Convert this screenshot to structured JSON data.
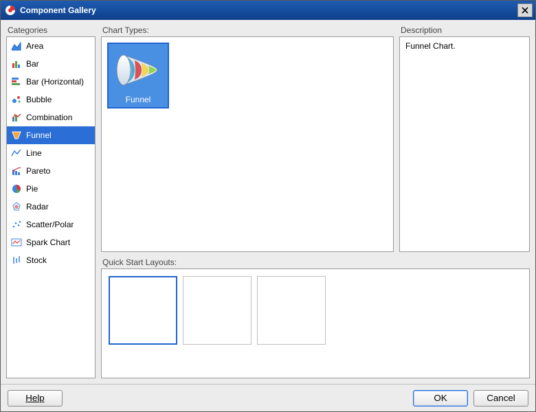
{
  "window": {
    "title": "Component Gallery"
  },
  "labels": {
    "categories": "Categories",
    "chart_types": "Chart Types:",
    "description": "Description",
    "quick_start": "Quick Start Layouts:"
  },
  "categories": {
    "selected_index": 5,
    "items": [
      {
        "label": "Area",
        "icon": "area"
      },
      {
        "label": "Bar",
        "icon": "bar"
      },
      {
        "label": "Bar (Horizontal)",
        "icon": "bar-h"
      },
      {
        "label": "Bubble",
        "icon": "bubble"
      },
      {
        "label": "Combination",
        "icon": "combination"
      },
      {
        "label": "Funnel",
        "icon": "funnel"
      },
      {
        "label": "Line",
        "icon": "line"
      },
      {
        "label": "Pareto",
        "icon": "pareto"
      },
      {
        "label": "Pie",
        "icon": "pie"
      },
      {
        "label": "Radar",
        "icon": "radar"
      },
      {
        "label": "Scatter/Polar",
        "icon": "scatter"
      },
      {
        "label": "Spark Chart",
        "icon": "spark"
      },
      {
        "label": "Stock",
        "icon": "stock"
      }
    ]
  },
  "chart_types": {
    "selected_index": 0,
    "items": [
      {
        "label": "Funnel"
      }
    ]
  },
  "description": {
    "text": "Funnel Chart."
  },
  "quick_start": {
    "selected_index": 0,
    "items": [
      {
        "layout": "funnel-with-legend"
      },
      {
        "layout": "funnel-with-title-legend"
      },
      {
        "layout": "funnel-plain"
      }
    ]
  },
  "buttons": {
    "help": "Help",
    "ok": "OK",
    "cancel": "Cancel"
  }
}
